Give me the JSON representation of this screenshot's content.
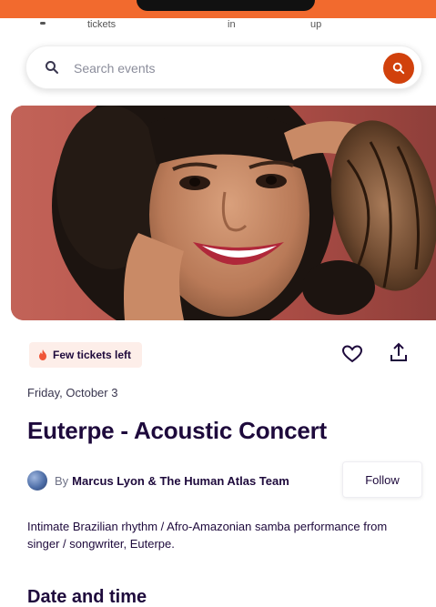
{
  "top_nav": {
    "items": [
      "tickets",
      "in",
      "up"
    ]
  },
  "search": {
    "placeholder": "Search events"
  },
  "event": {
    "badge": "Few tickets left",
    "date": "Friday, October 3",
    "title": "Euterpe - Acoustic Concert",
    "organizer_prefix": "By",
    "organizer_name": "Marcus Lyon & The Human Atlas Team",
    "follow_label": "Follow",
    "summary": "Intimate Brazilian rhythm / Afro-Amazonian samba performance from singer / songwriter, Euterpe."
  },
  "sections": {
    "date_and_time": "Date and time"
  },
  "colors": {
    "brand_orange": "#f26a2e",
    "search_button": "#d1410c",
    "badge_bg": "#fdeee9",
    "text_dark": "#1e0a3c"
  },
  "icons": [
    "search-icon",
    "heart-icon",
    "share-icon",
    "fire-icon",
    "avatar"
  ]
}
